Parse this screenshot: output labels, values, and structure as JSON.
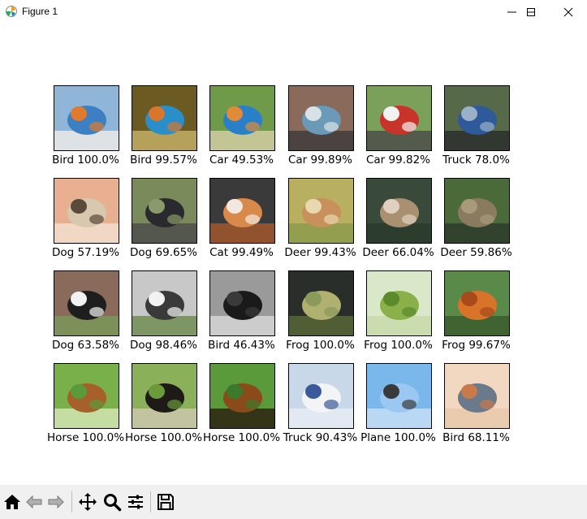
{
  "window": {
    "title": "Figure 1",
    "controls": {
      "minimize": "minimize-icon",
      "maximize": "maximize-icon",
      "close": "close-icon"
    }
  },
  "figure": {
    "images": [
      {
        "label": "Bird 100.0%",
        "subject": "kingfisher"
      },
      {
        "label": "Bird 99.57%",
        "subject": "kingfisher"
      },
      {
        "label": "Car 49.53%",
        "subject": "kingfisher on branch"
      },
      {
        "label": "Car 99.89%",
        "subject": "vintage blue car"
      },
      {
        "label": "Car 99.82%",
        "subject": "red classic car"
      },
      {
        "label": "Truck 78.0%",
        "subject": "blue beetle car"
      },
      {
        "label": "Dog 57.19%",
        "subject": "tabby cat"
      },
      {
        "label": "Dog 69.65%",
        "subject": "dark cat"
      },
      {
        "label": "Cat 99.49%",
        "subject": "orange and white cat"
      },
      {
        "label": "Deer 99.43%",
        "subject": "deer"
      },
      {
        "label": "Deer 66.04%",
        "subject": "deer"
      },
      {
        "label": "Deer 59.86%",
        "subject": "deer"
      },
      {
        "label": "Dog 63.58%",
        "subject": "black and white dog"
      },
      {
        "label": "Dog 98.46%",
        "subject": "husky"
      },
      {
        "label": "Bird 46.43%",
        "subject": "black labrador"
      },
      {
        "label": "Frog 100.0%",
        "subject": "frog"
      },
      {
        "label": "Frog 100.0%",
        "subject": "frog"
      },
      {
        "label": "Frog 99.67%",
        "subject": "orange frog"
      },
      {
        "label": "Horse 100.0%",
        "subject": "running horse"
      },
      {
        "label": "Horse 100.0%",
        "subject": "dark horse"
      },
      {
        "label": "Horse 100.0%",
        "subject": "brown horse"
      },
      {
        "label": "Truck 90.43%",
        "subject": "airplane front"
      },
      {
        "label": "Plane 100.0%",
        "subject": "airplane in sky"
      },
      {
        "label": "Bird 68.11%",
        "subject": "biplane"
      }
    ]
  },
  "toolbar": {
    "buttons": [
      "home-icon",
      "back-icon",
      "forward-icon",
      "pan-icon",
      "zoom-icon",
      "configure-icon",
      "save-icon"
    ]
  }
}
